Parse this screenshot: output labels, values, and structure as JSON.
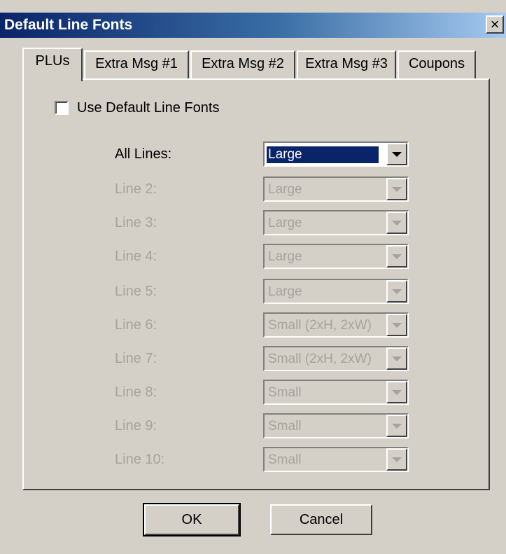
{
  "window": {
    "title": "Default Line Fonts",
    "close_glyph": "×"
  },
  "tabs": [
    {
      "label": "PLUs",
      "active": true
    },
    {
      "label": "Extra Msg #1",
      "active": false
    },
    {
      "label": "Extra Msg #2",
      "active": false
    },
    {
      "label": "Extra Msg #3",
      "active": false
    },
    {
      "label": "Coupons",
      "active": false
    }
  ],
  "panel": {
    "use_default_label": "Use Default Line Fonts",
    "use_default_checked": false,
    "rows": [
      {
        "label": "All Lines:",
        "value": "Large",
        "enabled": true
      },
      {
        "label": "Line 2:",
        "value": "Large",
        "enabled": false
      },
      {
        "label": "Line 3:",
        "value": "Large",
        "enabled": false
      },
      {
        "label": "Line 4:",
        "value": "Large",
        "enabled": false
      },
      {
        "label": "Line 5:",
        "value": "Large",
        "enabled": false
      },
      {
        "label": "Line 6:",
        "value": "Small (2xH, 2xW)",
        "enabled": false
      },
      {
        "label": "Line 7:",
        "value": "Small (2xH, 2xW)",
        "enabled": false
      },
      {
        "label": "Line 8:",
        "value": "Small",
        "enabled": false
      },
      {
        "label": "Line 9:",
        "value": "Small",
        "enabled": false
      },
      {
        "label": "Line 10:",
        "value": "Small",
        "enabled": false
      }
    ]
  },
  "buttons": {
    "ok_label": "OK",
    "cancel_label": "Cancel"
  },
  "icons": {
    "close": "close-icon",
    "dropdown": "chevron-down-icon"
  },
  "colors": {
    "dialog_bg": "#d4d0c8",
    "title_gradient_start": "#0a246a",
    "title_gradient_end": "#a6caf0",
    "selection": "#0a246a",
    "disabled_text": "#a6a39c"
  }
}
